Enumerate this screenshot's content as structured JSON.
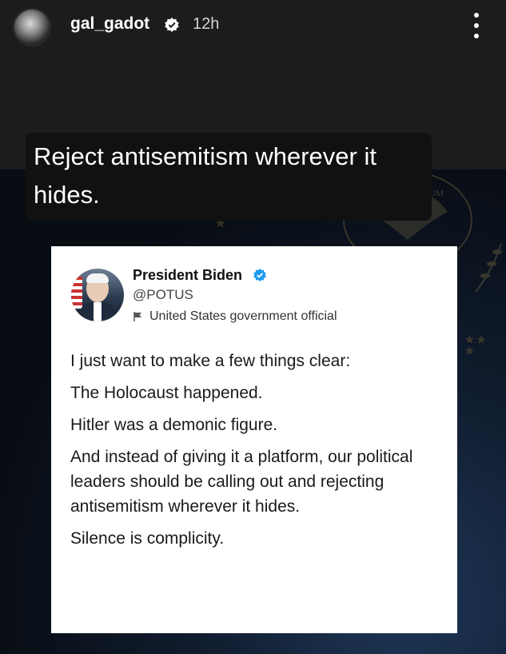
{
  "story": {
    "username": "gal_gadot",
    "time": "12h",
    "caption_lines": [
      "Reject antisemitism wherever it",
      "hides."
    ]
  },
  "tweet": {
    "name": "President Biden",
    "handle": "@POTUS",
    "label": "United States government official",
    "paragraphs": [
      "I just want to make a few things clear:",
      "The Holocaust happened.",
      "Hitler was a demonic figure.",
      "And instead of giving it a platform, our political leaders should be calling out and rejecting antisemitism wherever it hides.",
      "Silence is complicity."
    ]
  },
  "background": {
    "seal_text": "PLURIBUS UNUM"
  },
  "icons": [
    "verified-icon",
    "more-options-icon",
    "flag-icon",
    "verified-blue-icon"
  ],
  "colors": {
    "verified_blue": "#1d9bf0",
    "story_top": "#1c1c1e",
    "background_navy": "#0f1a2b"
  }
}
